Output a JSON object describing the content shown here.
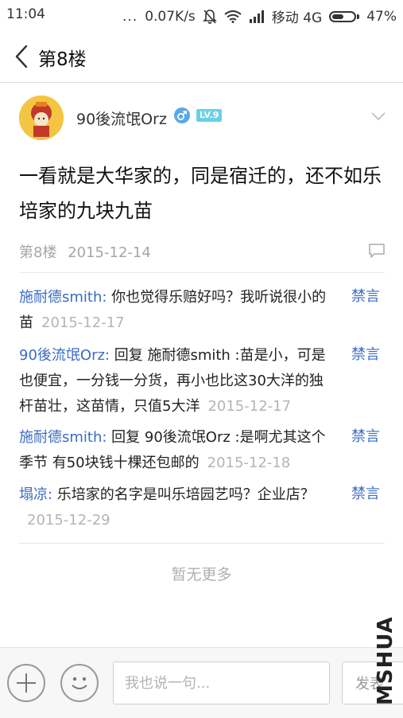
{
  "status_bar": {
    "time": "11:04",
    "dots": "...",
    "speed": "0.07K/s",
    "carrier": "移动 4G",
    "battery": "47%",
    "battery_level": 0.47
  },
  "header": {
    "title": "第8楼"
  },
  "post": {
    "username": "90後流氓Orz",
    "gender_icon": "male-icon",
    "level": "LV.9",
    "content": "一看就是大华家的，同是宿迁的，还不如乐培家的九块九苗",
    "floor": "第8楼",
    "date": "2015-12-14"
  },
  "replies": [
    {
      "author": "施耐德smith:",
      "text": " 你也觉得乐赔好吗？我听说很小的苗",
      "time": "2015-12-17",
      "action": "禁言"
    },
    {
      "author": "90後流氓Orz:",
      "text": " 回复 施耐德smith :苗是小，可是也便宜，一分钱一分货，再小也比这30大洋的独杆苗壮，这苗情，只值5大洋",
      "time": "2015-12-17",
      "action": "禁言"
    },
    {
      "author": "施耐德smith:",
      "text": " 回复 90後流氓Orz :是啊尤其这个季节 有50块钱十棵还包邮的",
      "time": "2015-12-18",
      "action": "禁言"
    },
    {
      "author": "塌凉:",
      "text": " 乐培家的名字是叫乐培园艺吗？企业店？",
      "time": "2015-12-29",
      "action": "禁言"
    }
  ],
  "no_more": "暂无更多",
  "bottom_bar": {
    "placeholder": "我也说一句...",
    "send": "发表"
  },
  "watermark": "MSHUA"
}
